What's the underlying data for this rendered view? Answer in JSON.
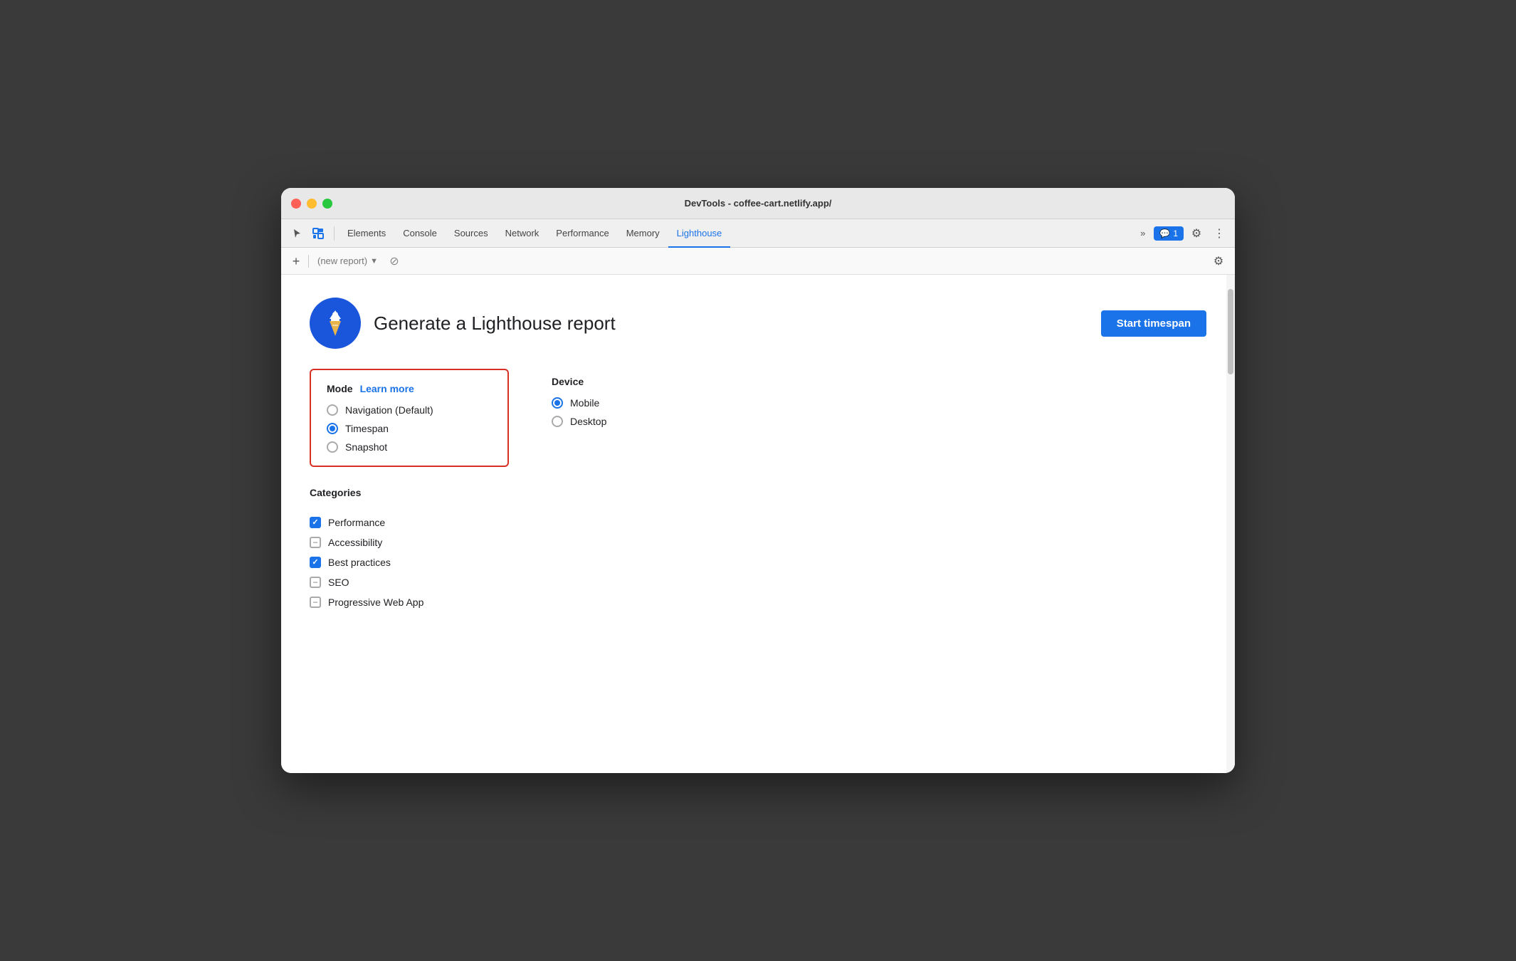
{
  "window": {
    "title": "DevTools - coffee-cart.netlify.app/"
  },
  "tabs": {
    "items": [
      {
        "label": "Elements",
        "active": false
      },
      {
        "label": "Console",
        "active": false
      },
      {
        "label": "Sources",
        "active": false
      },
      {
        "label": "Network",
        "active": false
      },
      {
        "label": "Performance",
        "active": false
      },
      {
        "label": "Memory",
        "active": false
      },
      {
        "label": "Lighthouse",
        "active": true
      }
    ],
    "more_label": "»",
    "badge_icon": "💬",
    "badge_count": "1"
  },
  "toolbar": {
    "add_label": "+",
    "report_placeholder": "(new report)",
    "cancel_label": "⊘"
  },
  "header": {
    "title": "Generate a Lighthouse report",
    "start_button_label": "Start timespan"
  },
  "mode": {
    "title": "Mode",
    "learn_more_label": "Learn more",
    "options": [
      {
        "label": "Navigation (Default)",
        "selected": false
      },
      {
        "label": "Timespan",
        "selected": true
      },
      {
        "label": "Snapshot",
        "selected": false
      }
    ]
  },
  "device": {
    "title": "Device",
    "options": [
      {
        "label": "Mobile",
        "selected": true
      },
      {
        "label": "Desktop",
        "selected": false
      }
    ]
  },
  "categories": {
    "title": "Categories",
    "items": [
      {
        "label": "Performance",
        "state": "checked"
      },
      {
        "label": "Accessibility",
        "state": "indeterminate"
      },
      {
        "label": "Best practices",
        "state": "checked"
      },
      {
        "label": "SEO",
        "state": "indeterminate"
      },
      {
        "label": "Progressive Web App",
        "state": "indeterminate"
      }
    ]
  },
  "colors": {
    "accent_blue": "#1a73e8",
    "mode_border_red": "#d93025"
  }
}
